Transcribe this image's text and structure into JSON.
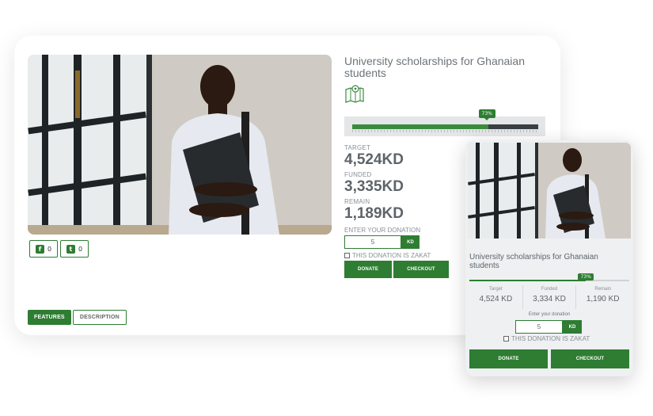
{
  "campaign": {
    "title": "University scholarships for Ghanaian students",
    "progress_label": "73%",
    "progress_percent": 73
  },
  "desktop": {
    "share": [
      {
        "icon": "facebook-icon",
        "glyph": "f",
        "count": "0"
      },
      {
        "icon": "twitter-icon",
        "glyph": "t",
        "count": "0"
      }
    ],
    "tabs": [
      "FEATURES",
      "DESCRIPTION"
    ],
    "stats": [
      {
        "label": "TARGET",
        "value": "4,524KD"
      },
      {
        "label": "FUNDED",
        "value": "3,335KD"
      },
      {
        "label": "REMAIN",
        "value": "1,189KD"
      }
    ],
    "donation_label": "ENTER YOUR DONATION",
    "donation_value": "5",
    "currency": "KD",
    "zakat_label": "THIS DONATION IS ZAKAT",
    "donate_label": "DONATE",
    "checkout_label": "CHECKOUT"
  },
  "mobile": {
    "title": "University scholarships for Ghanaian students",
    "progress_label": "73%",
    "stats": [
      {
        "label": "Target",
        "value": "4,524 KD"
      },
      {
        "label": "Funded",
        "value": "3,334 KD"
      },
      {
        "label": "Remain",
        "value": "1,190 KD"
      }
    ],
    "donation_label": "Enter your donation",
    "donation_value": "5",
    "currency": "KD",
    "zakat_label": "THIS DONATION IS ZAKAT",
    "donate_label": "DONATE",
    "checkout_label": "CHECKOUT"
  },
  "colors": {
    "accent": "#2e7d32",
    "text_gray": "#5e646a"
  }
}
